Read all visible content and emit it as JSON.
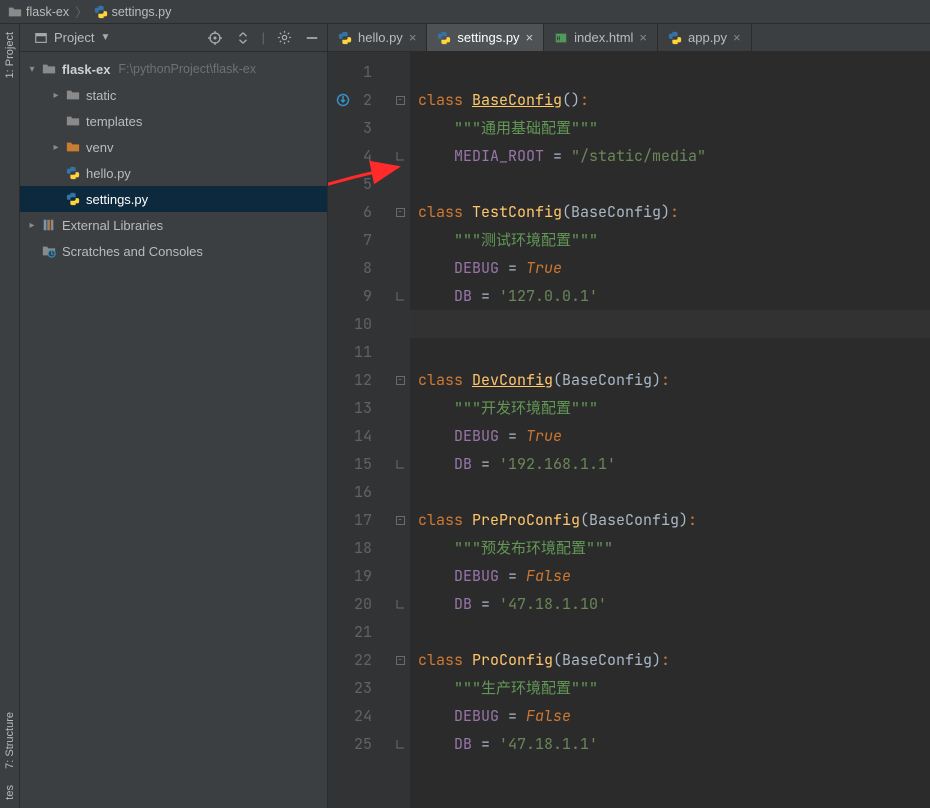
{
  "breadcrumb": {
    "root_label": "flask-ex",
    "file_label": "settings.py"
  },
  "project_panel": {
    "title": "Project",
    "tree": {
      "root": {
        "label": "flask-ex",
        "path": "F:\\pythonProject\\flask-ex"
      },
      "static": {
        "label": "static"
      },
      "templates": {
        "label": "templates"
      },
      "venv": {
        "label": "venv"
      },
      "hello": {
        "label": "hello.py"
      },
      "settings": {
        "label": "settings.py"
      },
      "external": {
        "label": "External Libraries"
      },
      "scratches": {
        "label": "Scratches and Consoles"
      }
    }
  },
  "side_tabs": {
    "project": "1: Project",
    "structure": "7: Structure",
    "favorites": "tes"
  },
  "tabs": [
    {
      "label": "hello.py"
    },
    {
      "label": "settings.py"
    },
    {
      "label": "index.html"
    },
    {
      "label": "app.py"
    }
  ],
  "code": {
    "lines": [
      {
        "n": "1",
        "raw": ""
      },
      {
        "n": "2",
        "kw": "class ",
        "cls": "BaseConfig",
        "rest": "():"
      },
      {
        "n": "3",
        "doc": "    \"\"\"通用基础配置\"\"\""
      },
      {
        "n": "4",
        "assign": {
          "indent": "    ",
          "name": "MEDIA_ROOT",
          "val": "\"/static/media\""
        }
      },
      {
        "n": "5",
        "raw": ""
      },
      {
        "n": "6",
        "kw": "class ",
        "cls2": "TestConfig",
        "base": "(BaseConfig):"
      },
      {
        "n": "7",
        "doc": "    \"\"\"测试环境配置\"\"\""
      },
      {
        "n": "8",
        "assign": {
          "indent": "    ",
          "name": "DEBUG",
          "kwval": "True"
        }
      },
      {
        "n": "9",
        "assign": {
          "indent": "    ",
          "name": "DB",
          "val": "'127.0.0.1'"
        }
      },
      {
        "n": "10",
        "caret": true,
        "raw": ""
      },
      {
        "n": "11",
        "raw": ""
      },
      {
        "n": "12",
        "kw": "class ",
        "cls": "DevConfig",
        "base": "(BaseConfig):"
      },
      {
        "n": "13",
        "doc": "    \"\"\"开发环境配置\"\"\""
      },
      {
        "n": "14",
        "assign": {
          "indent": "    ",
          "name": "DEBUG",
          "kwval": "True"
        }
      },
      {
        "n": "15",
        "assign": {
          "indent": "    ",
          "name": "DB",
          "val": "'192.168.1.1'"
        }
      },
      {
        "n": "16",
        "raw": ""
      },
      {
        "n": "17",
        "kw": "class ",
        "cls2": "PreProConfig",
        "base": "(BaseConfig):"
      },
      {
        "n": "18",
        "doc": "    \"\"\"预发布环境配置\"\"\""
      },
      {
        "n": "19",
        "assign": {
          "indent": "    ",
          "name": "DEBUG",
          "kwval": "False"
        }
      },
      {
        "n": "20",
        "assign": {
          "indent": "    ",
          "name": "DB",
          "val": "'47.18.1.10'"
        }
      },
      {
        "n": "21",
        "raw": ""
      },
      {
        "n": "22",
        "kw": "class ",
        "cls2": "ProConfig",
        "base": "(BaseConfig):"
      },
      {
        "n": "23",
        "doc": "    \"\"\"生产环境配置\"\"\""
      },
      {
        "n": "24",
        "assign": {
          "indent": "    ",
          "name": "DEBUG",
          "kwval": "False"
        }
      },
      {
        "n": "25",
        "assign": {
          "indent": "    ",
          "name": "DB",
          "val": "'47.18.1.1'"
        }
      }
    ]
  }
}
